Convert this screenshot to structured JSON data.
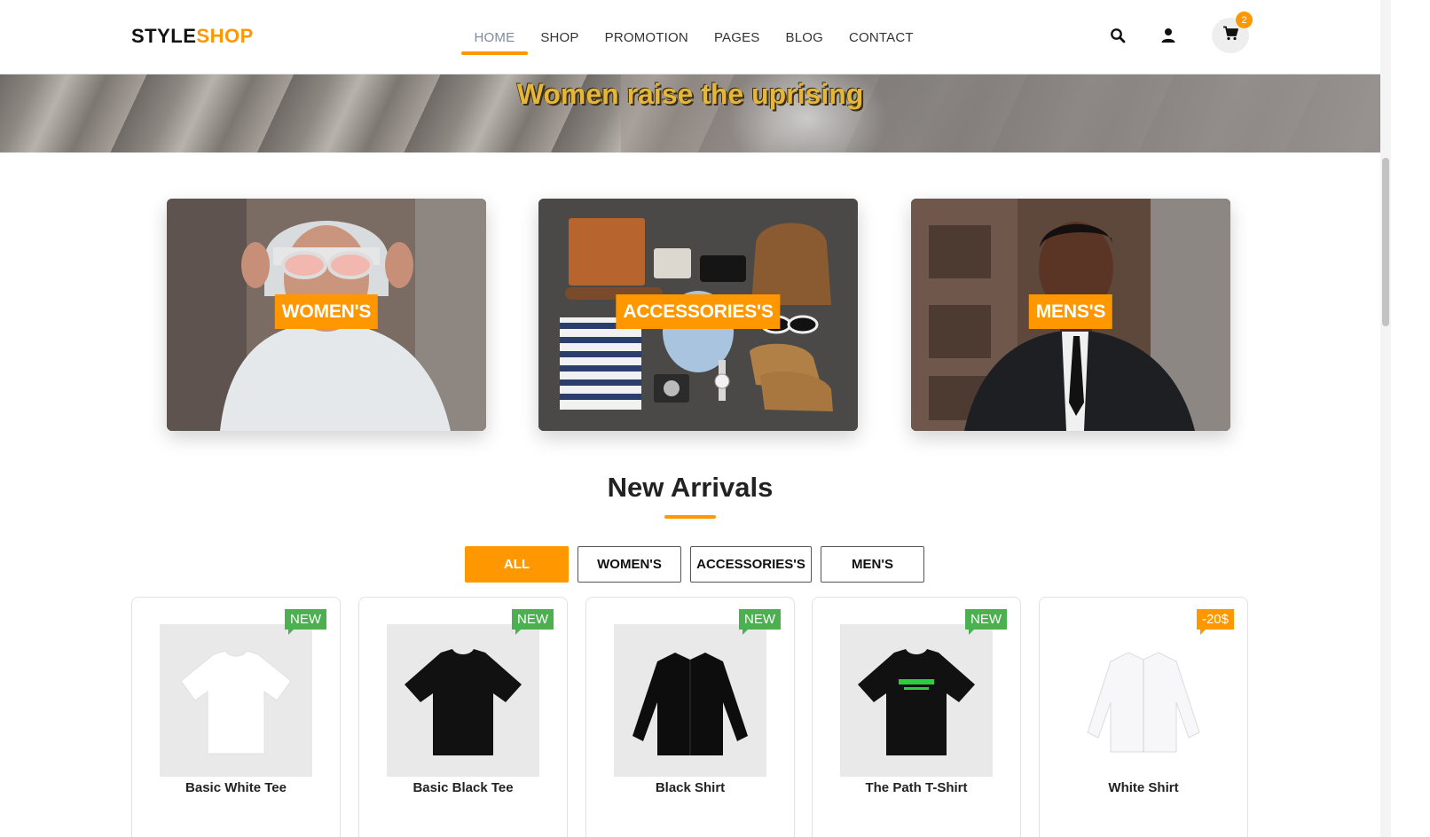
{
  "header": {
    "logo_primary": "STYLE",
    "logo_accent": "SHOP",
    "nav": [
      {
        "label": "HOME",
        "active": true
      },
      {
        "label": "SHOP",
        "active": false
      },
      {
        "label": "PROMOTION",
        "active": false
      },
      {
        "label": "PAGES",
        "active": false
      },
      {
        "label": "BLOG",
        "active": false
      },
      {
        "label": "CONTACT",
        "active": false
      }
    ],
    "cart_count": "2",
    "icons": [
      "search-icon",
      "user-icon",
      "cart-icon"
    ]
  },
  "hero": {
    "caption": "Women raise the uprising"
  },
  "categories": [
    {
      "label": "WOMEN'S"
    },
    {
      "label": "ACCESSORIES'S"
    },
    {
      "label": "MENS'S"
    }
  ],
  "new_arrivals": {
    "title": "New Arrivals",
    "filters": [
      {
        "label": "ALL",
        "active": true
      },
      {
        "label": "WOMEN'S",
        "active": false
      },
      {
        "label": "ACCESSORIES'S",
        "active": false
      },
      {
        "label": "MEN'S",
        "active": false
      }
    ],
    "products": [
      {
        "name": "Basic White Tee",
        "badge": "NEW"
      },
      {
        "name": "Basic Black Tee",
        "badge": "NEW"
      },
      {
        "name": "Black Shirt",
        "badge": "NEW"
      },
      {
        "name": "The Path T-Shirt",
        "badge": "NEW"
      },
      {
        "name": "White Shirt",
        "badge": "-20$"
      }
    ]
  },
  "colors": {
    "accent": "#ff9800",
    "badge_new": "#4caf50",
    "nav_active": "#7d8aa0"
  }
}
